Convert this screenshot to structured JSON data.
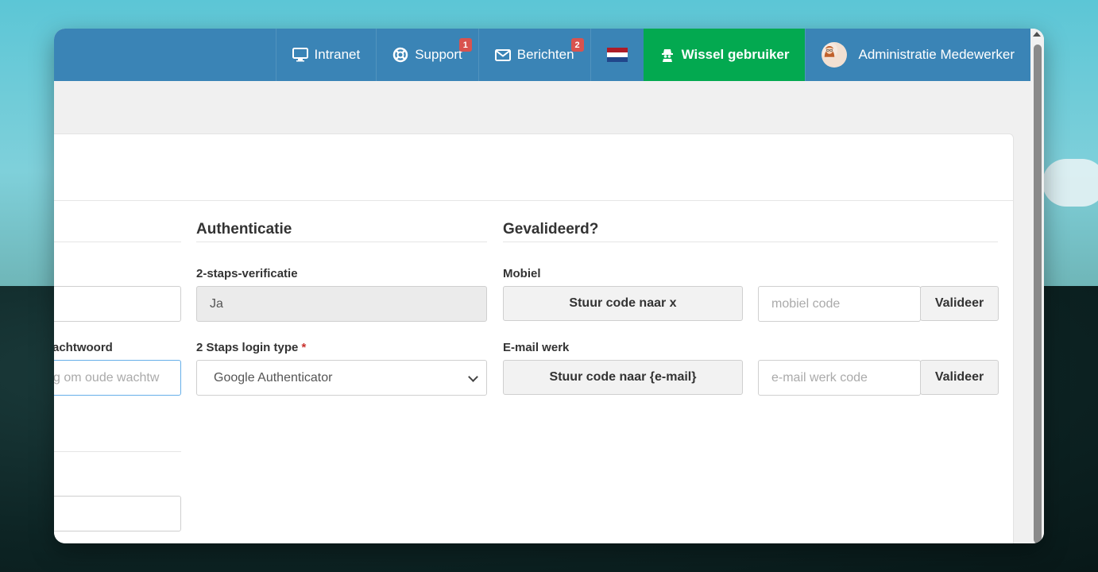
{
  "topbar": {
    "intranet": "Intranet",
    "support": "Support",
    "support_badge": "1",
    "messages": "Berichten",
    "messages_badge": "2",
    "switch_user": "Wissel gebruiker",
    "user_name": "Administratie Medewerker"
  },
  "left_column": {
    "password_label_fragment": "achtwoord",
    "password_placeholder_fragment": "g om oude wachtw"
  },
  "authentication": {
    "title": "Authenticatie",
    "two_step_label": "2-staps-verificatie",
    "two_step_value": "Ja",
    "login_type_label": "2 Staps login type",
    "login_type_required": "*",
    "login_type_value": "Google Authenticator"
  },
  "validated": {
    "title": "Gevalideerd?",
    "mobile_label": "Mobiel",
    "mobile_send_button": "Stuur code naar x",
    "mobile_code_placeholder": "mobiel code",
    "mobile_validate_button": "Valideer",
    "email_label": "E-mail werk",
    "email_send_button": "Stuur code naar {e-mail}",
    "email_code_placeholder": "e-mail werk code",
    "email_validate_button": "Valideer"
  },
  "colors": {
    "topbar": "#3a84b6",
    "switch_user_bg": "#03a950",
    "badge": "#d9534f"
  }
}
